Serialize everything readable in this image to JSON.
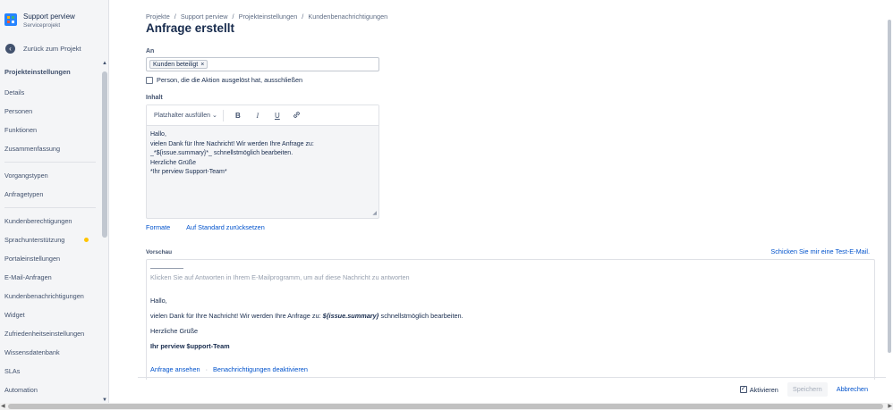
{
  "sidebar": {
    "project_name": "Support perview",
    "project_type": "Serviceprojekt",
    "back_label": "Zurück zum Projekt",
    "section_title": "Projekteinstellungen",
    "items": [
      {
        "label": "Details"
      },
      {
        "label": "Personen"
      },
      {
        "label": "Funktionen"
      },
      {
        "label": "Zusammenfassung"
      },
      {
        "label": "Vorgangstypen"
      },
      {
        "label": "Anfragetypen"
      },
      {
        "label": "Kundenberechtigungen"
      },
      {
        "label": "Sprachunterstützung"
      },
      {
        "label": "Portaleinstellungen"
      },
      {
        "label": "E-Mail-Anfragen"
      },
      {
        "label": "Kundenbenachrichtigungen"
      },
      {
        "label": "Widget"
      },
      {
        "label": "Zufriedenheitseinstellungen"
      },
      {
        "label": "Wissensdatenbank"
      },
      {
        "label": "SLAs"
      },
      {
        "label": "Automation"
      }
    ],
    "status_dot_color": "#ffc400"
  },
  "breadcrumb": [
    "Projekte",
    "Support perview",
    "Projekteinstellungen",
    "Kundenbenachrichtigungen"
  ],
  "page_title": "Anfrage erstellt",
  "recipients": {
    "label": "An",
    "tag": "Kunden beteiligt",
    "exclude_label": "Person, die die Aktion ausgelöst hat, ausschließen"
  },
  "content": {
    "label": "Inhalt",
    "placeholder_dropdown": "Platzhalter ausfüllen",
    "toolbar": {
      "bold": "B",
      "italic": "I",
      "underline": "U"
    },
    "lines": [
      "Hallo,",
      "",
      "vielen Dank für Ihre Nachricht! Wir werden Ihre Anfrage zu:",
      "_*${issue.summary}*_ schnellstmöglich bearbeiten.",
      "",
      "Herzliche Grüße",
      "",
      "*Ihr perview Support-Team*"
    ],
    "link_formats": "Formate",
    "link_reset": "Auf Standard zurücksetzen"
  },
  "preview": {
    "label": "Vorschau",
    "test_mail_link": "Schicken Sie mir eine Test-E-Mail.",
    "hint": "Klicken Sie auf Antworten in Ihrem E-Mailprogramm, um auf diese Nachricht zu antworten",
    "greeting": "Hallo,",
    "body_before": "vielen Dank für Ihre Nachricht! Wir werden Ihre Anfrage zu: ",
    "body_var": "${issue.summary}",
    "body_after": " schnellstmöglich bearbeiten.",
    "regards": "Herzliche Grüße",
    "signature": "Ihr perview $upport-Team",
    "link_view": "Anfrage ansehen",
    "link_sep": "·",
    "link_disable": "Benachrichtigungen deaktivieren"
  },
  "footer": {
    "activate_label": "Aktivieren",
    "activate_checked": true,
    "save_label": "Speichern",
    "cancel_label": "Abbrechen"
  },
  "icons": {
    "back": "arrow-left-icon",
    "checkbox_checked": "✓",
    "tag_remove": "×",
    "dropdown": "chevron-down-icon",
    "link": "link-icon"
  },
  "colors": {
    "link": "#0052cc",
    "sidebar_bg": "#f4f5f7",
    "text": "#172b4d"
  }
}
